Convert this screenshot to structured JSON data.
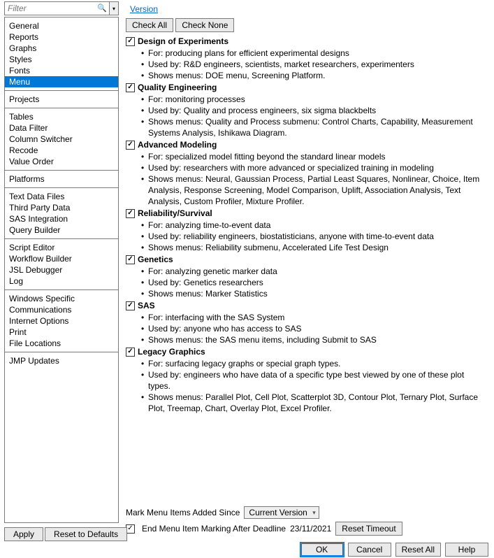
{
  "filter": {
    "placeholder": "Filter"
  },
  "version_link": "Version",
  "sidebar_groups": [
    [
      "General",
      "Reports",
      "Graphs",
      "Styles",
      "Fonts",
      "Menu"
    ],
    [
      "Projects"
    ],
    [
      "Tables",
      "Data Filter",
      "Column Switcher",
      "Recode",
      "Value Order"
    ],
    [
      "Platforms"
    ],
    [
      "Text Data Files",
      "Third Party Data",
      "SAS Integration",
      "Query Builder"
    ],
    [
      "Script Editor",
      "Workflow Builder",
      "JSL Debugger",
      "Log"
    ],
    [
      "Windows Specific",
      "Communications",
      "Internet Options",
      "Print",
      "File Locations"
    ],
    [
      "JMP Updates"
    ]
  ],
  "sidebar_selected": "Menu",
  "check_all": "Check All",
  "check_none": "Check None",
  "sections": [
    {
      "title": "Design of Experiments",
      "bullets": [
        "For: producing plans for efficient experimental designs",
        "Used by: R&D engineers, scientists, market researchers, experimenters",
        "Shows menus: DOE menu, Screening Platform."
      ]
    },
    {
      "title": "Quality Engineering",
      "bullets": [
        "For: monitoring processes",
        "Used by: Quality and process engineers, six sigma blackbelts",
        "Shows menus: Quality and Process submenu: Control Charts, Capability, Measurement Systems Analysis, Ishikawa Diagram."
      ]
    },
    {
      "title": "Advanced Modeling",
      "bullets": [
        "For: specialized model fitting beyond the standard linear models",
        "Used by: researchers with more advanced or specialized training in modeling",
        "Shows menus: Neural, Gaussian Process, Partial Least Squares, Nonlinear, Choice, Item Analysis, Response Screening, Model Comparison, Uplift, Association Analysis, Text Analysis, Custom Profiler, Mixture Profiler."
      ]
    },
    {
      "title": "Reliability/Survival",
      "bullets": [
        "For: analyzing time-to-event data",
        "Used by: reliability engineers, biostatisticians, anyone with time-to-event data",
        "Shows menus: Reliability submenu, Accelerated Life Test Design"
      ]
    },
    {
      "title": "Genetics",
      "bullets": [
        "For: analyzing genetic marker data",
        "Used by: Genetics researchers",
        "Shows menus: Marker Statistics"
      ]
    },
    {
      "title": "SAS",
      "bullets": [
        "For: interfacing with the SAS System",
        "Used by: anyone who has access to SAS",
        "Shows menus: the SAS menu items, including Submit to SAS"
      ]
    },
    {
      "title": "Legacy Graphics",
      "bullets": [
        "For: surfacing legacy graphs or special graph types.",
        "Used by: engineers who have data of a specific type best viewed by one of these plot types.",
        "Shows menus: Parallel Plot, Cell Plot, Scatterplot 3D, Contour Plot, Ternary Plot, Surface Plot, Treemap, Chart, Overlay Plot, Excel Profiler."
      ]
    }
  ],
  "mark_label": "Mark Menu Items Added Since",
  "mark_select": "Current Version",
  "deadline_checkbox": "End Menu Item Marking After Deadline",
  "deadline_date": "23/11/2021",
  "reset_timeout": "Reset Timeout",
  "apply": "Apply",
  "reset_defaults": "Reset to Defaults",
  "ok": "OK",
  "cancel": "Cancel",
  "reset_all": "Reset All",
  "help": "Help"
}
